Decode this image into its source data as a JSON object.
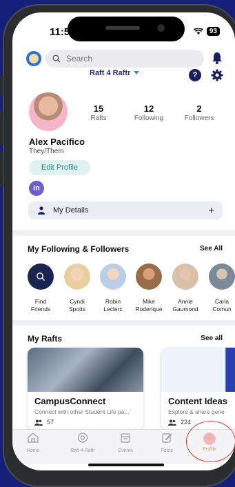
{
  "status": {
    "time": "11:59",
    "battery": "93"
  },
  "search": {
    "placeholder": "Search"
  },
  "community": {
    "name": "Raft 4 Raftr"
  },
  "profile": {
    "stats": [
      {
        "value": "15",
        "label": "Rafts"
      },
      {
        "value": "12",
        "label": "Following"
      },
      {
        "value": "2",
        "label": "Followers"
      }
    ],
    "name": "Alex Pacifico",
    "pronouns": "They/Them",
    "edit_label": "Edit Profile",
    "linkedin": "in",
    "details_label": "My Details"
  },
  "following": {
    "title": "My Following & Followers",
    "see_all": "See All",
    "people": [
      {
        "line1": "Find",
        "line2": "Friends",
        "color": "#1c2550"
      },
      {
        "line1": "Cyndi",
        "line2": "Spotts",
        "color": "#e8cfa0"
      },
      {
        "line1": "Robin",
        "line2": "Leclerc",
        "color": "#b9cfe8"
      },
      {
        "line1": "Mike",
        "line2": "Roderique",
        "color": "#9b6b4a"
      },
      {
        "line1": "Annie",
        "line2": "Gaumond",
        "color": "#d9c0a8"
      },
      {
        "line1": "Carla",
        "line2": "Comun",
        "color": "#7a8a99"
      }
    ]
  },
  "rafts": {
    "title": "My Rafts",
    "see_all": "See all",
    "cards": [
      {
        "title": "CampusConnect",
        "desc": "Connect with other Student Life pa...",
        "members": "57"
      },
      {
        "title": "Content Ideas",
        "desc": "Explore & share gene",
        "members": "224"
      }
    ]
  },
  "nav": [
    {
      "label": "Home",
      "icon": "home-icon"
    },
    {
      "label": "Raft 4 Raftr",
      "icon": "raft-icon"
    },
    {
      "label": "Events",
      "icon": "calendar-icon"
    },
    {
      "label": "Posts",
      "icon": "edit-icon"
    },
    {
      "label": "Profile",
      "icon": "profile-avatar"
    }
  ],
  "colors": {
    "background": "#14207a",
    "accent": "#2f8a86",
    "nav_active": "#c8a14a",
    "highlight": "#e63a3a"
  }
}
